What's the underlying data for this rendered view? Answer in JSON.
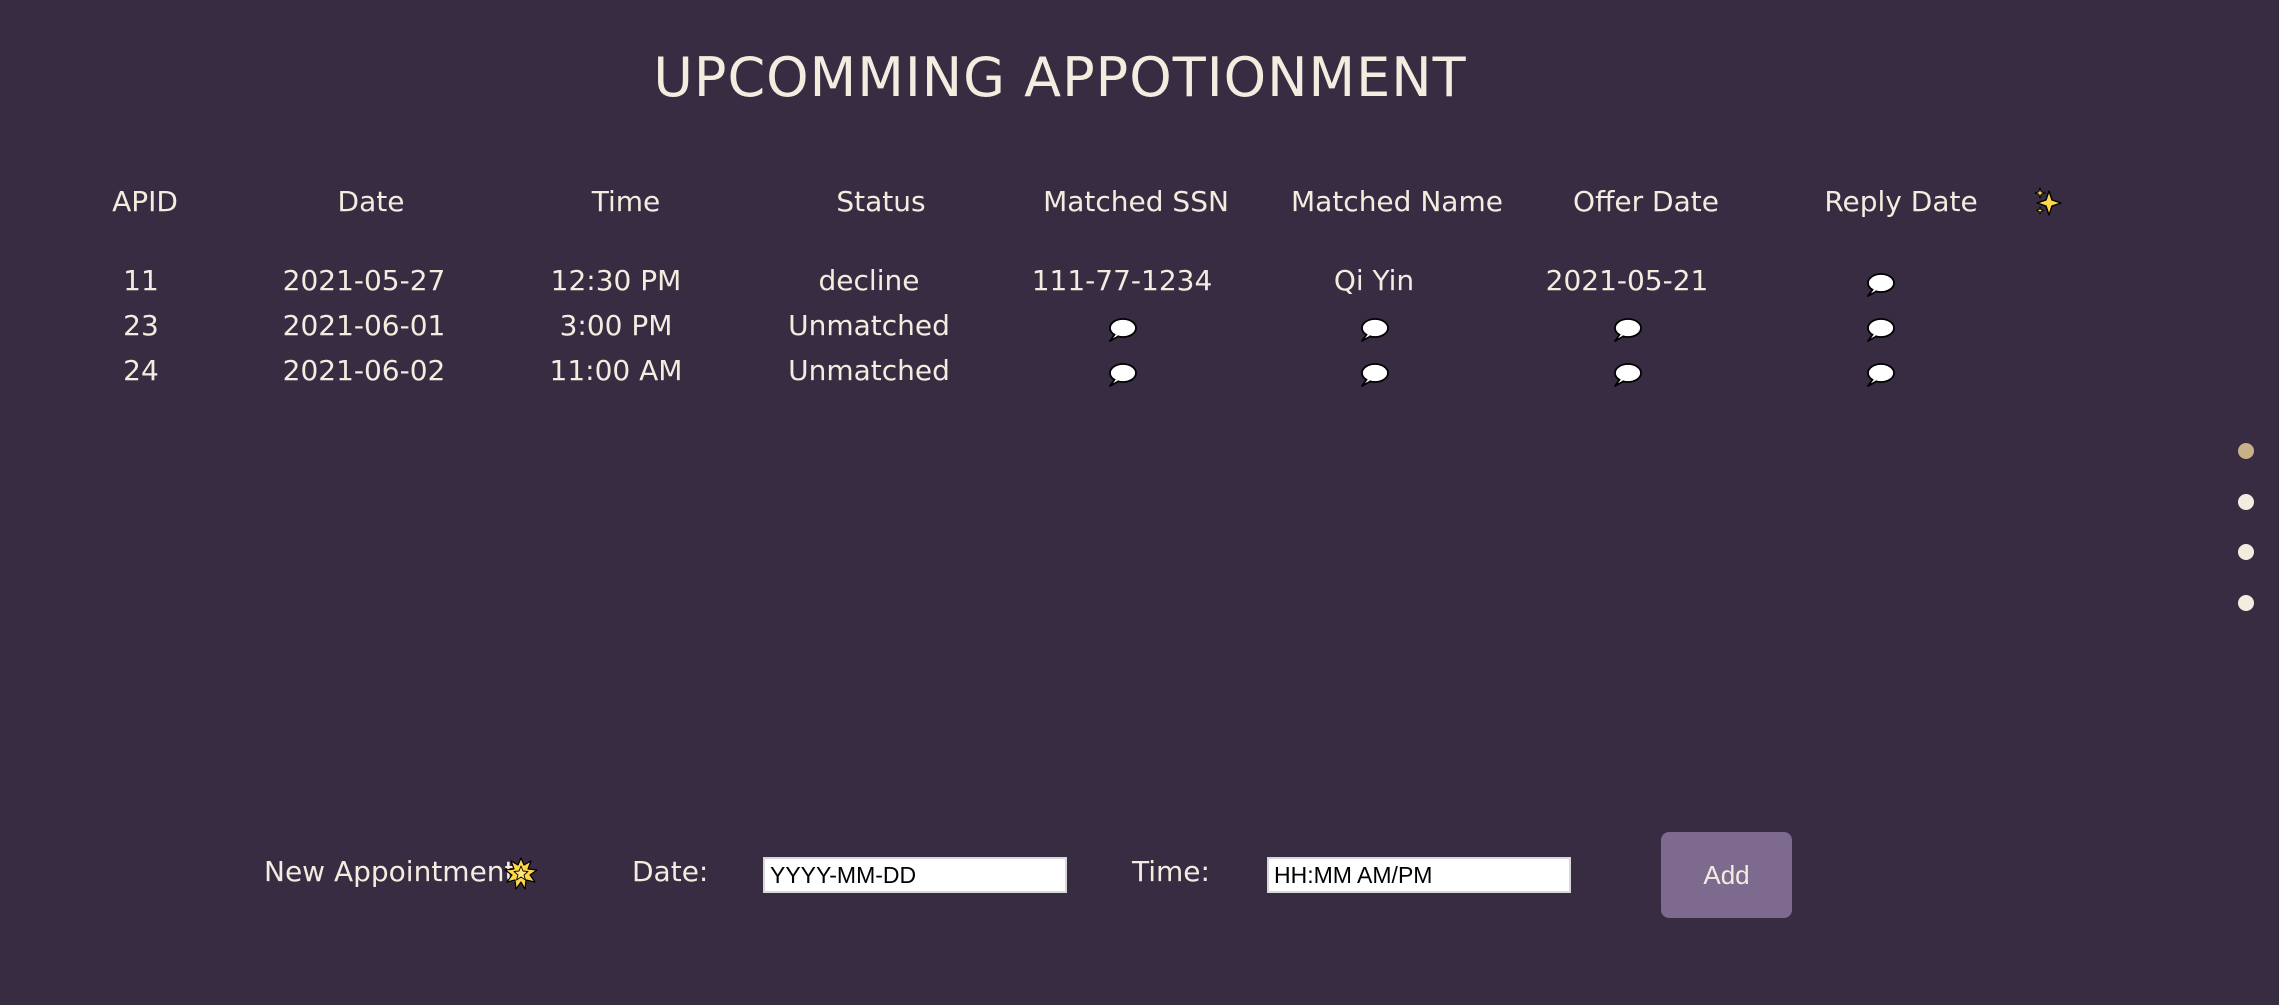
{
  "page": {
    "title": "UPCOMMING APPOTIONMENT"
  },
  "table": {
    "columns": [
      "APID",
      "Date",
      "Time",
      "Status",
      "Matched SSN",
      "Matched Name",
      "Offer Date",
      "Reply Date"
    ],
    "header_icon": "sparkles-icon",
    "empty_cell_icon": "speech-balloon-icon",
    "rows": [
      {
        "apid": "11",
        "date": "2021-05-27",
        "time": "12:30 PM",
        "status": "decline",
        "matched_ssn": "111-77-1234",
        "matched_name": "Qi Yin",
        "offer_date": "2021-05-21",
        "reply_date": null
      },
      {
        "apid": "23",
        "date": "2021-06-01",
        "time": "3:00 PM",
        "status": "Unmatched",
        "matched_ssn": null,
        "matched_name": null,
        "offer_date": null,
        "reply_date": null
      },
      {
        "apid": "24",
        "date": "2021-06-02",
        "time": "11:00 AM",
        "status": "Unmatched",
        "matched_ssn": null,
        "matched_name": null,
        "offer_date": null,
        "reply_date": null
      }
    ]
  },
  "pagination": {
    "dots": 4,
    "active_index": 0
  },
  "new_appointment": {
    "label": "New Appointment",
    "icon": "glowing-star-icon",
    "date_label": "Date:",
    "date_placeholder": "YYYY-MM-DD",
    "date_value": "",
    "time_label": "Time:",
    "time_placeholder": "HH:MM AM/PM",
    "time_value": "",
    "add_label": "Add"
  },
  "colors": {
    "background": "#372c42",
    "text": "#f3ede0",
    "button": "#7e6a8e",
    "active_dot": "#c8b088",
    "icon_yellow": "#ffd84a"
  }
}
